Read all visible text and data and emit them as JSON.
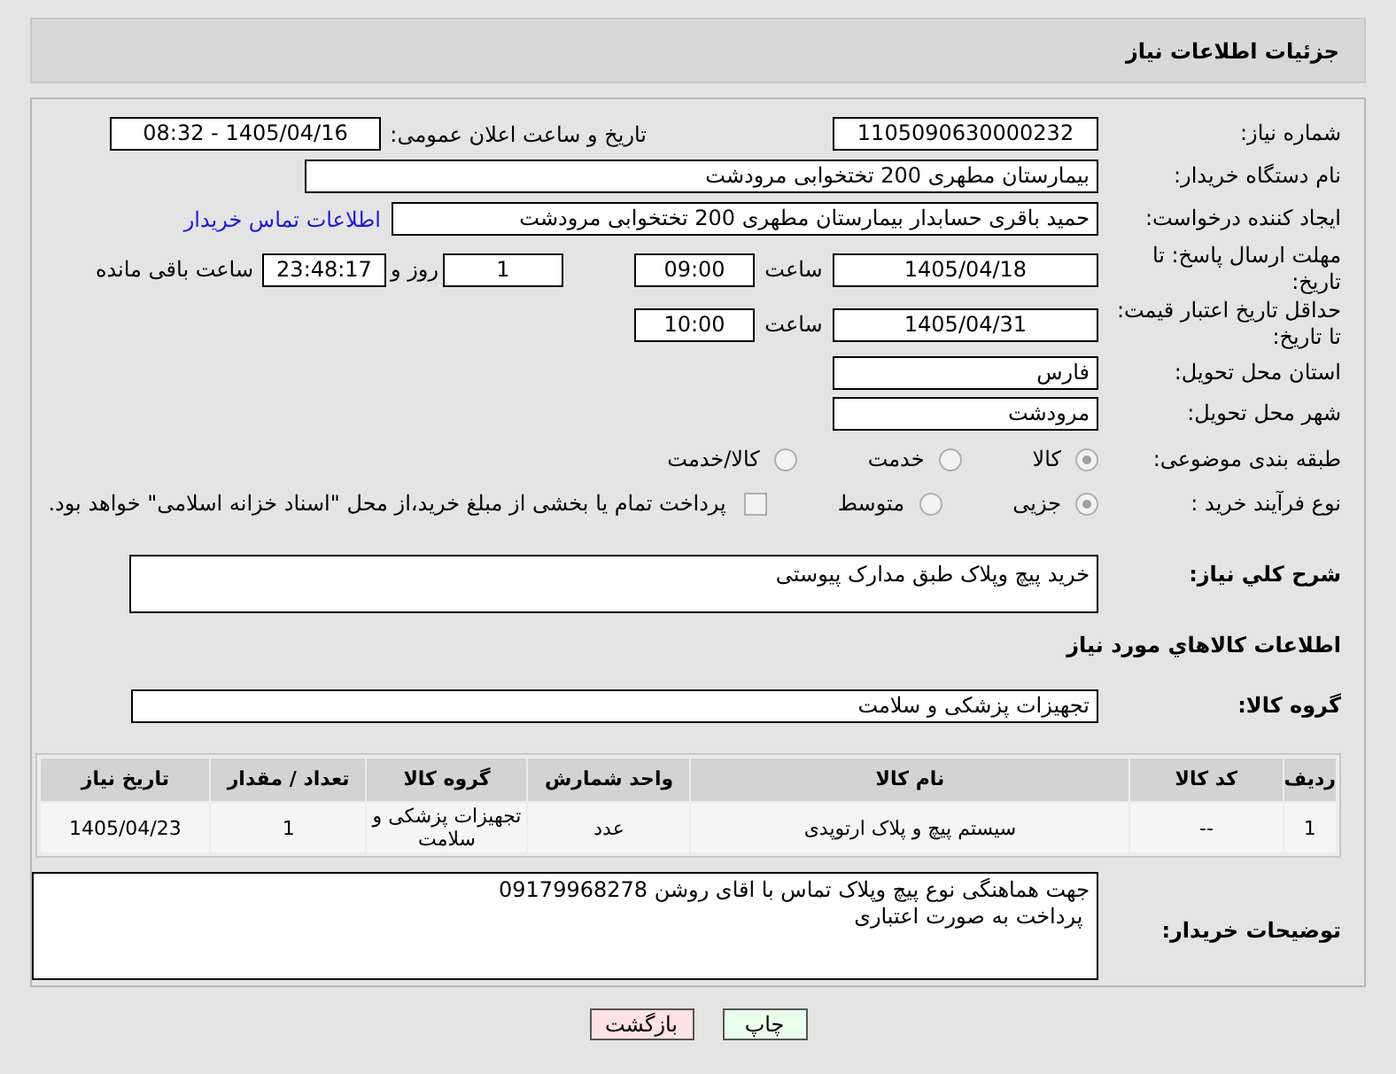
{
  "title": "جزئیات اطلاعات نیاز",
  "need_number": {
    "label": "شماره نیاز:",
    "value": "1105090630000232"
  },
  "announce": {
    "label": "تاریخ و ساعت اعلان عمومی:",
    "value": "1405/04/16 - 08:32"
  },
  "buyer_org": {
    "label": "نام دستگاه خریدار:",
    "value": "بیمارستان مطهری  200 تختخوابی مرودشت"
  },
  "requester": {
    "label": "ایجاد کننده درخواست:",
    "value": "حمید باقری حسابدار بیمارستان مطهری  200 تختخوابی مرودشت",
    "link": "اطلاعات تماس خریدار"
  },
  "reply_deadline": {
    "label": "مهلت ارسال پاسخ: تا تاریخ:",
    "date": "1405/04/18",
    "time_label": "ساعت",
    "time": "09:00",
    "days": "1",
    "days_label": "روز و",
    "remaining": "23:48:17",
    "remaining_label": "ساعت باقی مانده"
  },
  "price_validity": {
    "label": "حداقل تاریخ اعتبار قیمت: تا تاریخ:",
    "date": "1405/04/31",
    "time_label": "ساعت",
    "time": "10:00"
  },
  "province": {
    "label": "استان محل تحویل:",
    "value": "فارس"
  },
  "city": {
    "label": "شهر محل تحویل:",
    "value": "مرودشت"
  },
  "category": {
    "label": "طبقه بندی موضوعی:",
    "options": [
      {
        "label": "کالا",
        "selected": true
      },
      {
        "label": "خدمت",
        "selected": false
      },
      {
        "label": "کالا/خدمت",
        "selected": false
      }
    ]
  },
  "process": {
    "label": "نوع فرآیند خرید :",
    "options": [
      {
        "label": "جزیی",
        "selected": true
      },
      {
        "label": "متوسط",
        "selected": false
      }
    ],
    "payment": {
      "label": "پرداخت تمام یا بخشی از مبلغ خرید،از محل \"اسناد خزانه اسلامی\" خواهد بود.",
      "checked": false
    }
  },
  "description": {
    "label": "شرح کلي نياز:",
    "value": "خرید پیچ وپلاک طبق مدارک پیوستی"
  },
  "goods_title": "اطلاعات كالاهاي مورد نياز",
  "goods_group": {
    "label": "گروه کالا:",
    "value": "تجهیزات پزشکی و سلامت"
  },
  "table": {
    "columns": [
      "ردیف",
      "کد کالا",
      "نام کالا",
      "واحد شمارش",
      "گروه کالا",
      "تعداد / مقدار",
      "تاریخ نیاز"
    ],
    "rows": [
      [
        "1",
        "--",
        "سیستم پیچ و پلاک ارتوپدی",
        "عدد",
        "تجهیزات پزشکی و سلامت",
        "1",
        "1405/04/23"
      ]
    ]
  },
  "buyer_notes": {
    "label": "توضیحات خریدار:",
    "lines": [
      "جهت هماهنگی نوع پیچ وپلاک تماس با اقای روشن 09179968278",
      " پرداخت به صورت اعتباری"
    ]
  },
  "buttons": [
    {
      "label": "چاپ",
      "kind": "print"
    },
    {
      "label": "بازگشت",
      "kind": "back"
    }
  ]
}
